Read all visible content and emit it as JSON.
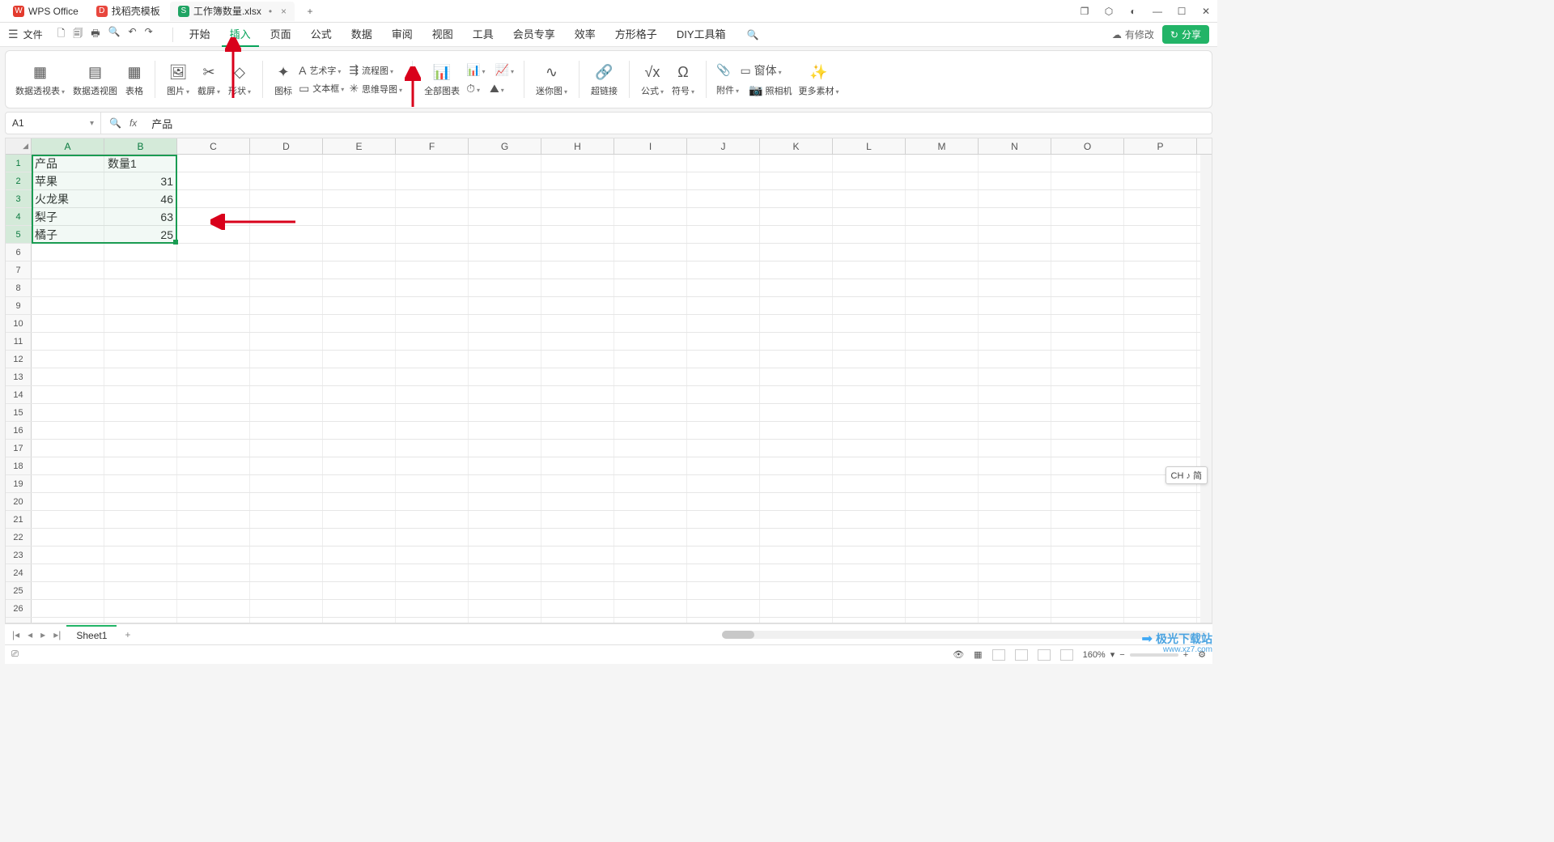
{
  "titlebar": {
    "app_tab": "WPS Office",
    "template_tab": "找稻壳模板",
    "doc_tab": "工作簿数量.xlsx",
    "doc_modified_indicator": "•",
    "close_glyph": "×",
    "newtab_glyph": "+",
    "win": {
      "copy": "❐",
      "cube": "⬡",
      "avatar": "◐",
      "min": "—",
      "max": "☐",
      "close": "✕"
    }
  },
  "menubar": {
    "file_label": "文件",
    "qat": [
      "🗋",
      "🗐",
      "🖶",
      "🔍",
      "↶",
      "↷"
    ],
    "tabs": [
      "开始",
      "插入",
      "页面",
      "公式",
      "数据",
      "审阅",
      "视图",
      "工具",
      "会员专享",
      "效率",
      "方形格子",
      "DIY工具箱"
    ],
    "active_tab_index": 1,
    "search_glyph": "🔍",
    "pending_edit": "有修改",
    "cloud_glyph": "☁",
    "share_label": "分享",
    "share_glyph": "↻"
  },
  "ribbon": {
    "g1": [
      {
        "lbl": "数据透视表"
      },
      {
        "lbl": "数据透视图"
      },
      {
        "lbl": "表格"
      }
    ],
    "g2": [
      {
        "lbl": "图片"
      },
      {
        "lbl": "截屏"
      },
      {
        "lbl": "形状"
      }
    ],
    "g3_top": [
      {
        "t": "艺术字"
      },
      {
        "t": "流程图"
      }
    ],
    "g3_icon": "图标",
    "g3_bot": [
      {
        "t": "文本框"
      },
      {
        "t": "思维导图"
      }
    ],
    "g4": {
      "all": "全部图表",
      "icons": [
        "📊",
        "⏱",
        "📈"
      ]
    },
    "g5": {
      "lbl": "迷你图"
    },
    "g6": {
      "lbl": "超链接"
    },
    "g7": [
      {
        "lbl": "公式"
      },
      {
        "lbl": "符号"
      }
    ],
    "g8_top": {
      "t": "窗体"
    },
    "g8": [
      {
        "lbl": "附件"
      },
      {
        "lbl": "照相机"
      },
      {
        "lbl": "更多素材"
      }
    ]
  },
  "formula": {
    "namebox": "A1",
    "fx": "fx",
    "content": "产品",
    "search": "🔍"
  },
  "grid": {
    "columns": [
      "A",
      "B",
      "C",
      "D",
      "E",
      "F",
      "G",
      "H",
      "I",
      "J",
      "K",
      "L",
      "M",
      "N",
      "O",
      "P"
    ],
    "selected_cols": [
      0,
      1
    ],
    "rows": 27,
    "selected_rows": [
      1,
      2,
      3,
      4,
      5
    ],
    "data": [
      [
        "产品",
        "数量1"
      ],
      [
        "苹果",
        "31"
      ],
      [
        "火龙果",
        "46"
      ],
      [
        "梨子",
        "63"
      ],
      [
        "橘子",
        "25"
      ]
    ],
    "numeric_cols": [
      1
    ]
  },
  "sheetbar": {
    "nav": [
      "|◂",
      "◂",
      "▸",
      "▸|"
    ],
    "sheet": "Sheet1",
    "add": "+"
  },
  "status": {
    "left_glyph": "⎚",
    "eye": "👁",
    "grid": "▦",
    "views": [
      "▭",
      "▥",
      "▤",
      "◫"
    ],
    "zoom": "160%",
    "minus": "−",
    "plus": "+",
    "settings": "⚙"
  },
  "ime": "CH ♪ 简",
  "watermark": {
    "t": "极光下载站",
    "u": "www.xz7.com"
  },
  "chart_data": {
    "type": "table",
    "title": "",
    "columns": [
      "产品",
      "数量1"
    ],
    "rows": [
      {
        "产品": "苹果",
        "数量1": 31
      },
      {
        "产品": "火龙果",
        "数量1": 46
      },
      {
        "产品": "梨子",
        "数量1": 63
      },
      {
        "产品": "橘子",
        "数量1": 25
      }
    ]
  }
}
